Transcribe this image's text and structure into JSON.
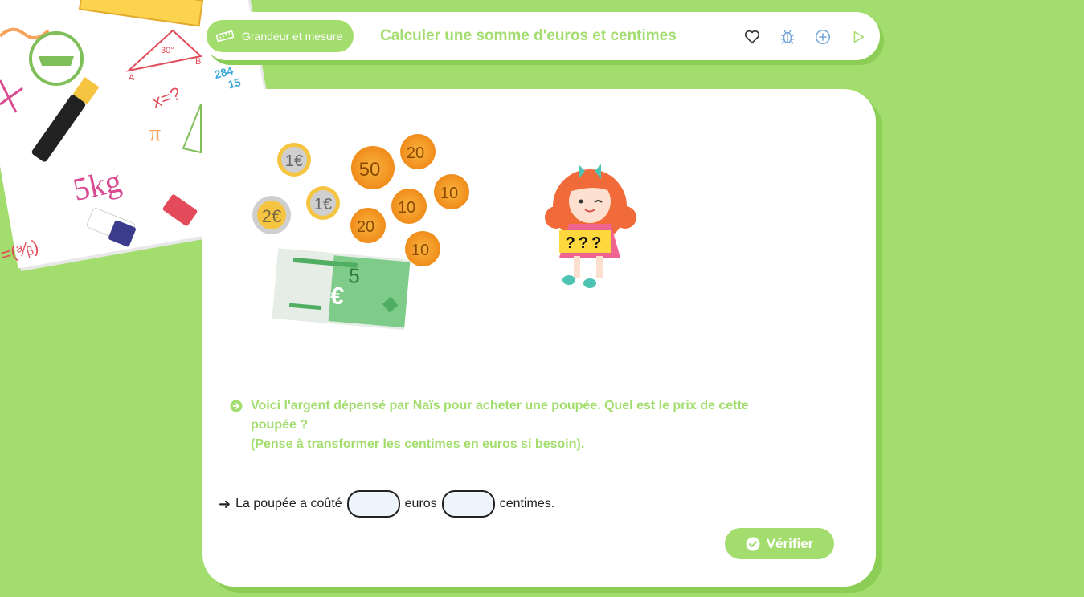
{
  "header": {
    "category_label": "Grandeur et mesure",
    "title": "Calculer une somme d'euros et centimes",
    "icons": [
      "heart-icon",
      "bug-icon",
      "plus-circle-icon",
      "play-icon"
    ]
  },
  "decor": {
    "paper_text": [
      "5kg",
      "x=?",
      "30°",
      "284",
      "15",
      "A",
      "B",
      "π"
    ]
  },
  "illustration": {
    "coins": [
      {
        "label": "1€",
        "type": "euro"
      },
      {
        "label": "2€",
        "type": "euro"
      },
      {
        "label": "1€",
        "type": "euro"
      },
      {
        "label": "50",
        "type": "cent"
      },
      {
        "label": "20",
        "type": "cent"
      },
      {
        "label": "10",
        "type": "cent"
      },
      {
        "label": "10",
        "type": "cent"
      },
      {
        "label": "20",
        "type": "cent"
      },
      {
        "label": "10",
        "type": "cent"
      }
    ],
    "banknote": {
      "value": "5",
      "symbol": "€"
    },
    "sign_text": "???"
  },
  "question": {
    "line1": "Voici l'argent dépensé par Naïs pour acheter une poupée. Quel est le prix de cette",
    "line2": "poupée ?",
    "line3": "(Pense à transformer les centimes en euros si besoin)."
  },
  "answer": {
    "arrow": "➜",
    "prefix": "La poupée a coûté",
    "middle": "euros",
    "suffix": "centimes."
  },
  "verify_label": "Vérifier",
  "colors": {
    "background": "#a3dd6e",
    "accent": "#a3dd6e",
    "card": "#ffffff",
    "icon_blue": "#6ea3d8"
  }
}
